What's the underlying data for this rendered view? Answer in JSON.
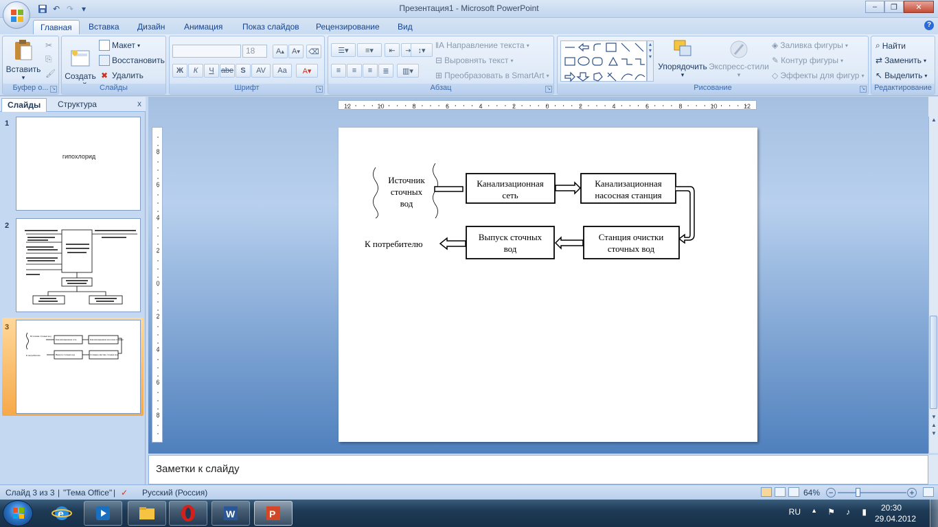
{
  "window": {
    "title": "Презентация1 - Microsoft PowerPoint"
  },
  "tabs": [
    "Главная",
    "Вставка",
    "Дизайн",
    "Анимация",
    "Показ слайдов",
    "Рецензирование",
    "Вид"
  ],
  "ribbon": {
    "clipboard": {
      "paste": "Вставить",
      "label": "Буфер о..."
    },
    "slides": {
      "new_slide": "Создать\nслайд",
      "layout": "Макет",
      "reset": "Восстановить",
      "delete": "Удалить",
      "label": "Слайды"
    },
    "font": {
      "size": "18",
      "label": "Шрифт",
      "bold": "Ж",
      "italic": "К",
      "underline": "Ч",
      "strike": "abe",
      "shadow": "S",
      "spacing": "AV",
      "case": "Aa"
    },
    "paragraph": {
      "text_direction": "Направление текста",
      "align_text": "Выровнять текст",
      "smartart": "Преобразовать в SmartArt",
      "label": "Абзац"
    },
    "drawing": {
      "arrange": "Упорядочить",
      "quick_styles": "Экспресс-стили",
      "shape_fill": "Заливка фигуры",
      "shape_outline": "Контур фигуры",
      "shape_effects": "Эффекты для фигур",
      "label": "Рисование"
    },
    "editing": {
      "find": "Найти",
      "replace": "Заменить",
      "select": "Выделить",
      "label": "Редактирование"
    }
  },
  "panel": {
    "tab_slides": "Слайды",
    "tab_outline": "Структура",
    "close": "x",
    "slide_numbers": [
      "1",
      "2",
      "3"
    ],
    "slide1_text": "гипохлорид"
  },
  "ruler": {
    "h_labels": [
      "12",
      "10",
      "8",
      "6",
      "4",
      "2",
      "0",
      "2",
      "4",
      "6",
      "8",
      "10",
      "12"
    ],
    "v_labels": [
      "8",
      "6",
      "4",
      "2",
      "0",
      "2",
      "4",
      "6",
      "8"
    ]
  },
  "diagram": {
    "source": "Источник\nсточных\nвод",
    "sewer": "Канализационная\nсеть",
    "pump": "Канализационная\nнасосная станция",
    "treatment": "Станция очистки\nсточных вод",
    "outlet": "Выпуск сточных\nвод",
    "consumer": "К потребителю"
  },
  "thumb3": {
    "source": "Источник сточных вод",
    "sewer": "Канализационная сеть",
    "pump": "Канализационная насосная станция",
    "treatment": "Станция очистки сточных вод",
    "outlet": "Выпуск сточных вод",
    "consumer": "К потребителю"
  },
  "notes": {
    "placeholder": "Заметки к слайду"
  },
  "status": {
    "slide": "Слайд 3 из 3",
    "theme": "\"Тема Office\"",
    "language": "Русский (Россия)",
    "zoom": "64%"
  },
  "tray": {
    "lang": "RU",
    "time": "20:30",
    "date": "29.04.2012"
  },
  "colors": {
    "accent": "#15428b",
    "selection": "#f6a949",
    "slide_bg": "#ffffff"
  }
}
